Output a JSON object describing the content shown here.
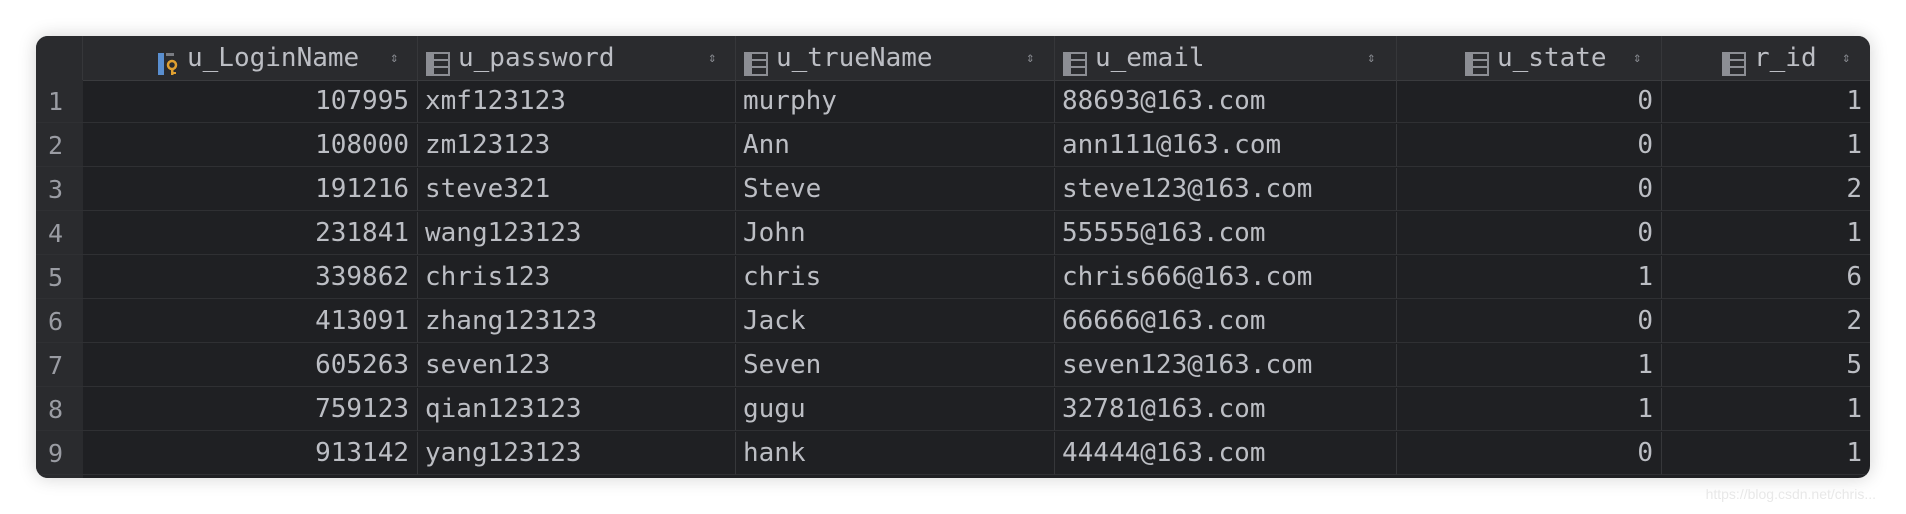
{
  "table": {
    "columns": [
      {
        "name": "u_LoginName",
        "icon": "primary-key-column-icon",
        "align": "right"
      },
      {
        "name": "u_password",
        "icon": "column-icon",
        "align": "left"
      },
      {
        "name": "u_trueName",
        "icon": "column-icon",
        "align": "left"
      },
      {
        "name": "u_email",
        "icon": "column-icon",
        "align": "left"
      },
      {
        "name": "u_state",
        "icon": "column-icon",
        "align": "right"
      },
      {
        "name": "r_id",
        "icon": "column-icon",
        "align": "right"
      }
    ],
    "sort_glyph": "⇕",
    "rows": [
      {
        "n": "1",
        "cells": [
          "107995",
          "xmf123123",
          "murphy",
          "88693@163.com",
          "0",
          "1"
        ]
      },
      {
        "n": "2",
        "cells": [
          "108000",
          "zm123123",
          "Ann",
          "ann111@163.com",
          "0",
          "1"
        ]
      },
      {
        "n": "3",
        "cells": [
          "191216",
          "steve321",
          "Steve",
          "steve123@163.com",
          "0",
          "2"
        ]
      },
      {
        "n": "4",
        "cells": [
          "231841",
          "wang123123",
          "John",
          "55555@163.com",
          "0",
          "1"
        ]
      },
      {
        "n": "5",
        "cells": [
          "339862",
          "chris123",
          "chris",
          "chris666@163.com",
          "1",
          "6"
        ]
      },
      {
        "n": "6",
        "cells": [
          "413091",
          "zhang123123",
          "Jack",
          "66666@163.com",
          "0",
          "2"
        ]
      },
      {
        "n": "7",
        "cells": [
          "605263",
          "seven123",
          "Seven",
          "seven123@163.com",
          "1",
          "5"
        ]
      },
      {
        "n": "8",
        "cells": [
          "759123",
          "qian123123",
          "gugu",
          "32781@163.com",
          "1",
          "1"
        ]
      },
      {
        "n": "9",
        "cells": [
          "913142",
          "yang123123",
          "hank",
          "44444@163.com",
          "0",
          "1"
        ]
      }
    ]
  },
  "watermark": "https://blog.csdn.net/chris...",
  "colors": {
    "background": "#1f2023",
    "header": "#2a2b2e",
    "text": "#bcbec4",
    "key_icon": "#e0a030"
  }
}
